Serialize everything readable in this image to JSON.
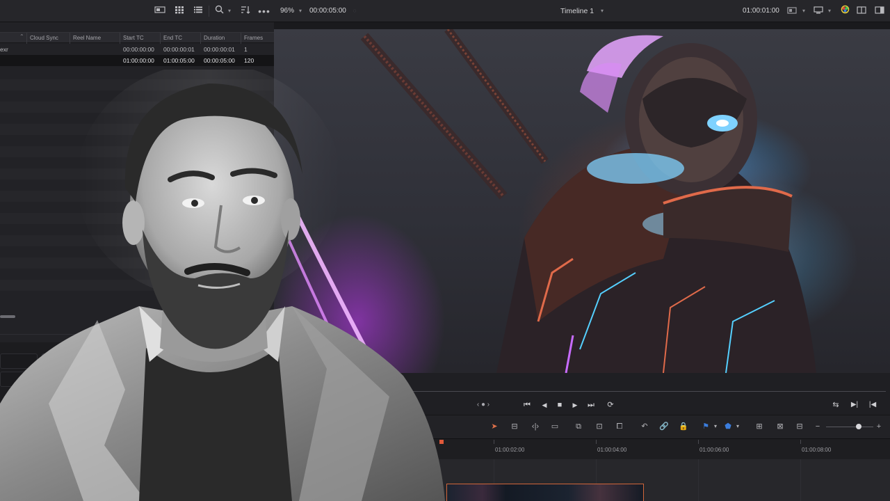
{
  "toolbar": {
    "zoom_level": "96%",
    "source_timecode": "00:00:05:00",
    "timeline_name": "Timeline 1",
    "record_timecode": "01:00:01:00",
    "icons": [
      "list-view-icon",
      "thumbnail-view-icon",
      "metadata-view-icon",
      "search-icon",
      "sort-icon",
      "more-options-icon"
    ]
  },
  "media_pool": {
    "columns": [
      "Cloud Sync",
      "Reel Name",
      "Start TC",
      "End TC",
      "Duration",
      "Frames"
    ],
    "rows": [
      {
        "name": "exr",
        "start_tc": "00:00:00:00",
        "end_tc": "00:00:00:01",
        "duration": "00:00:00:01",
        "frames": "1"
      },
      {
        "name": "",
        "start_tc": "01:00:00:00",
        "end_tc": "01:00:05:00",
        "duration": "00:00:05:00",
        "frames": "120"
      }
    ]
  },
  "transport": {
    "nav_label": "‹ ● ›"
  },
  "timeline": {
    "ruler_labels": [
      "01:00:02:00",
      "01:00:04:00",
      "01:00:06:00",
      "01:00:08:00"
    ]
  },
  "colors": {
    "accent_orange": "#d2663a",
    "flag_blue": "#3b7ddd",
    "ui_background": "#1c1c1f"
  }
}
